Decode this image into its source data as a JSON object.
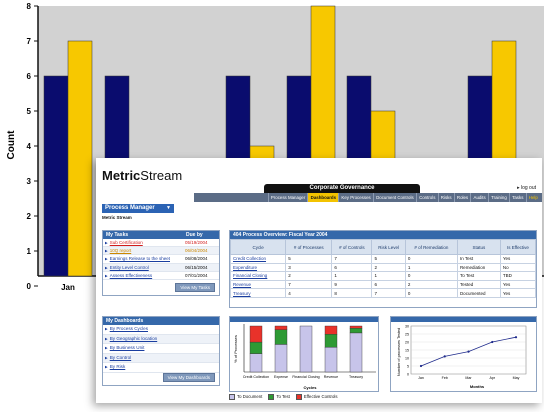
{
  "background_chart": {
    "y_axis_label": "Count",
    "y_ticks": [
      "0",
      "1",
      "2",
      "3",
      "4",
      "5",
      "6",
      "7",
      "8"
    ],
    "first_category": "Jan",
    "colors": {
      "navy": "#0a0c6e",
      "gold": "#f7c800"
    }
  },
  "chart_data": [
    {
      "type": "bar",
      "ylabel": "Count",
      "ylim": [
        0,
        8
      ],
      "categories": [
        "Jan",
        "",
        "",
        "",
        "",
        ""
      ],
      "series": [
        {
          "values": [
            6,
            6,
            6,
            6,
            6,
            6
          ]
        },
        {
          "values": [
            7,
            null,
            4,
            8,
            5,
            7
          ]
        }
      ]
    }
  ],
  "app": {
    "logo_bold": "Metric",
    "logo_rest": "Stream",
    "header_title": "Corporate Governance",
    "logout": "▸ log out",
    "nav_tabs": [
      "Process Manager",
      "Dashboards",
      "Key Processes",
      "Document Controls",
      "Controls",
      "Risks",
      "Roles",
      "Audits",
      "Training",
      "Tasks",
      "Help"
    ],
    "module_button": "Process Manager",
    "user_name": "Metric Stream"
  },
  "tasks": {
    "header_task": "My Tasks",
    "header_due": "Due by",
    "rows": [
      {
        "name": "Sub Certification",
        "due": "05/19/2004",
        "status": "overdue"
      },
      {
        "name": "10Q report",
        "due": "06/04/2004",
        "status": "warn"
      },
      {
        "name": "Earnings Release to the sheet",
        "due": "06/08/2004",
        "status": "normal"
      },
      {
        "name": "Entity Level Control",
        "due": "06/15/2004",
        "status": "normal"
      },
      {
        "name": "Assess Effectiveness",
        "due": "07/01/2004",
        "status": "normal"
      }
    ],
    "button": "View My Tasks"
  },
  "overview": {
    "title": "404 Process Overview: Fiscal Year 2004",
    "columns": [
      "Cycle",
      "# of Processes",
      "# of Controls",
      "Risk Level",
      "# of Remediation",
      "Status",
      "Is Effective"
    ],
    "rows": [
      [
        "Credit Collection",
        "5",
        "7",
        "5",
        "0",
        "In Test",
        "Yes"
      ],
      [
        "Expenditure",
        "3",
        "6",
        "2",
        "1",
        "Remediation",
        "No"
      ],
      [
        "Financial Closing",
        "2",
        "1",
        "1",
        "0",
        "To Test",
        "TBD"
      ],
      [
        "Revenue",
        "7",
        "9",
        "6",
        "2",
        "Tested",
        "Yes"
      ],
      [
        "Treasury",
        "4",
        "8",
        "7",
        "0",
        "Documented",
        "Yes"
      ]
    ]
  },
  "dashboards": {
    "header": "My Dashboards",
    "items": [
      "By Process Cycles",
      "By Geographic location",
      "By Business Unit",
      "By Control",
      "By Risk"
    ],
    "button": "View My Dashboards"
  },
  "mini_bar": {
    "ylabel": "% of Processes",
    "xlabel": "Cycles",
    "categories": [
      "Credit Collection",
      "Expense",
      "Financial Closing",
      "Revenue",
      "Treasury"
    ],
    "legend": [
      "To Document",
      "To Test",
      "Effective Controls"
    ]
  },
  "mini_line": {
    "ylabel": "Number of processes Tested",
    "xlabel": "Months",
    "categories": [
      "Jan",
      "Feb",
      "Mar",
      "Apr",
      "May"
    ],
    "y_ticks": [
      "0",
      "5",
      "10",
      "15",
      "20",
      "25",
      "30"
    ],
    "values": [
      5,
      11,
      14,
      20,
      23
    ]
  }
}
